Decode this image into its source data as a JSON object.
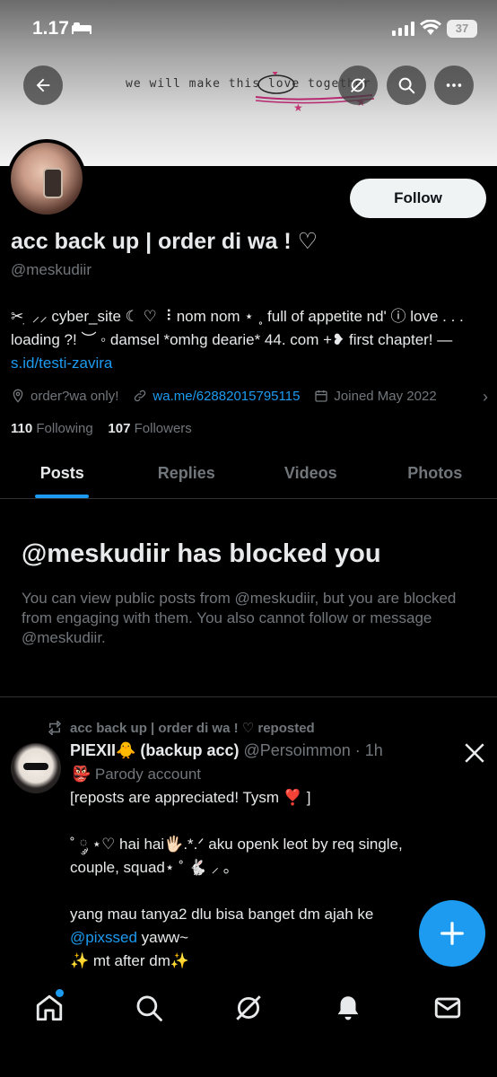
{
  "status_bar": {
    "time": "1.17",
    "battery": "37"
  },
  "banner": {
    "text": "we will make this love together"
  },
  "profile": {
    "follow_label": "Follow",
    "display_name": "acc back up | order di wa ! ♡",
    "handle": "@meskudiir",
    "bio": "✂︎ ׅ ⸝⸝ cyber_site ☾ ♡ ⠸ nom nom ⋆ ˳ full of appetite nd' ⓘ love . . . loading ?! ︶ ◦ damsel *omhg dearie* 44. com +❥ first chapter! — ",
    "bio_link": "s.id/testi-zavira",
    "location": "order?wa only!",
    "website": "wa.me/62882015795115",
    "joined": "Joined May 2022",
    "following_count": "110",
    "following_label": "Following",
    "followers_count": "107",
    "followers_label": "Followers"
  },
  "tabs": [
    {
      "label": "Posts"
    },
    {
      "label": "Replies"
    },
    {
      "label": "Videos"
    },
    {
      "label": "Photos"
    }
  ],
  "blocked": {
    "title": "@meskudiir has blocked you",
    "text": "You can view public posts from @meskudiir, but you are blocked from engaging with them. You also cannot follow or message @meskudiir."
  },
  "post": {
    "repost_label": "acc back up | order di wa ! ♡ reposted",
    "author_name": "PIEXII🐥 (backup acc)",
    "author_handle": "@Persoimmon · 1h",
    "parody_label": "👺 Parody account",
    "body_part1": "[reposts are appreciated! Tysm ❣️ ]\n\n˚ ༘ ⋆♡ hai hai🖐🏻.*.ᐟ aku openk leot by req single, couple, squad⋆ ˚ 🐇 ⸝ 。\n\nyang mau tanya2 dlu bisa banget dm ajah ke ",
    "mention": "@pixssed",
    "body_part2": " yaww~\n✨ mt after dm✨"
  },
  "icons": {
    "back": "back-arrow-icon",
    "grok": "grok-icon",
    "search": "search-icon",
    "more": "more-icon",
    "location": "location-icon",
    "link": "link-icon",
    "calendar": "calendar-icon",
    "repost": "repost-icon",
    "x_logo": "x-logo-icon",
    "compose": "plus-icon",
    "home": "home-icon",
    "notifications": "bell-icon",
    "messages": "mail-icon"
  },
  "colors": {
    "accent": "#1d9bf0",
    "background": "#000000",
    "muted": "#71767b"
  }
}
